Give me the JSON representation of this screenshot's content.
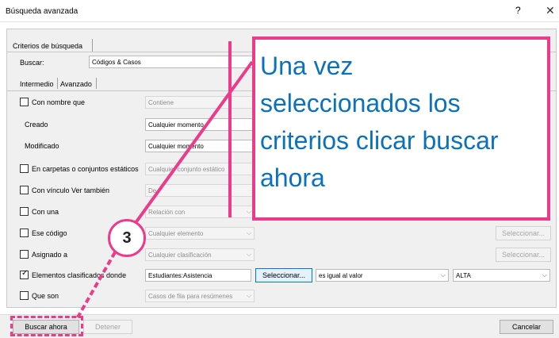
{
  "window": {
    "title": "Búsqueda avanzada",
    "help_label": "?",
    "close_label": "✕"
  },
  "tabs": {
    "criterios": "Criterios de búsqueda",
    "intermedio": "Intermedio",
    "avanzado": "Avanzado"
  },
  "buscar": {
    "label": "Buscar:",
    "value": "Códigos & Casos"
  },
  "rows": {
    "con_nombre_que": {
      "label": "Con nombre que",
      "value": "Contiene"
    },
    "creado": {
      "label": "Creado",
      "value": "Cualquier momento"
    },
    "modificado": {
      "label": "Modificado",
      "value": "Cualquier momento"
    },
    "en_carpetas": {
      "label": "En carpetas o conjuntos estáticos",
      "value": "Cualquier conjunto estático"
    },
    "con_vinculo": {
      "label": "Con vínculo Ver también",
      "value": "De"
    },
    "con_una": {
      "label": "Con una",
      "value": "Relación con"
    },
    "ese_codigo": {
      "label": "Ese código",
      "value": "Cualquier elemento",
      "button": "Seleccionar..."
    },
    "asignado_a": {
      "label": "Asignado a",
      "value": "Cualquier clasificación",
      "button": "Seleccionar..."
    },
    "elementos_clasificados": {
      "label": "Elementos clasificados donde",
      "attribute": "Estudiantes:Asistencia",
      "select_button": "Seleccionar...",
      "operator": "es igual al valor",
      "value": "ALTA",
      "checked": true
    },
    "que_son": {
      "label": "Que son",
      "value": "Casos de fila para resúmenes"
    }
  },
  "footer": {
    "search_now": "Buscar ahora",
    "stop": "Detener",
    "cancel": "Cancelar"
  },
  "annotation": {
    "callout_line1": "Una vez",
    "callout_line2": "seleccionados los",
    "callout_line3": "criterios clicar buscar",
    "callout_line4": "ahora",
    "step_number": "3",
    "accent_color": "#ec3b8a",
    "text_color": "#0a72bd"
  },
  "icons": {
    "dropdown": "chevron-down-icon",
    "checkmark": "checkmark-icon"
  }
}
